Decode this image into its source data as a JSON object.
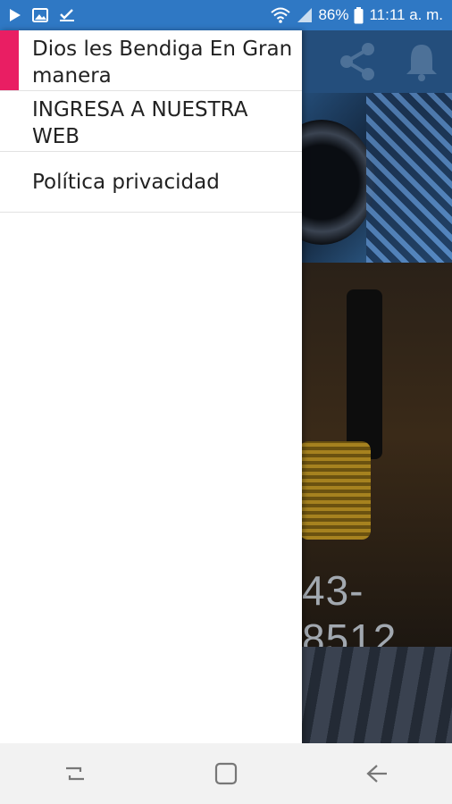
{
  "status_bar": {
    "left_icons": [
      "play-icon",
      "image-icon",
      "check-icon"
    ],
    "battery_percent": "86%",
    "time": "11:11 a. m."
  },
  "app": {
    "actions": [
      "share-icon",
      "bell-icon"
    ],
    "phone_fragment": "43-8512"
  },
  "drawer": {
    "items": [
      {
        "label": "Dios les Bendiga En Gran manera",
        "active": true
      },
      {
        "label": "INGRESA A NUESTRA WEB",
        "active": false
      },
      {
        "label": "Política privacidad",
        "active": false
      }
    ],
    "accent_color": "#e91e63"
  },
  "nav_bar": {
    "buttons": [
      "recents-icon",
      "home-icon",
      "back-icon"
    ]
  }
}
